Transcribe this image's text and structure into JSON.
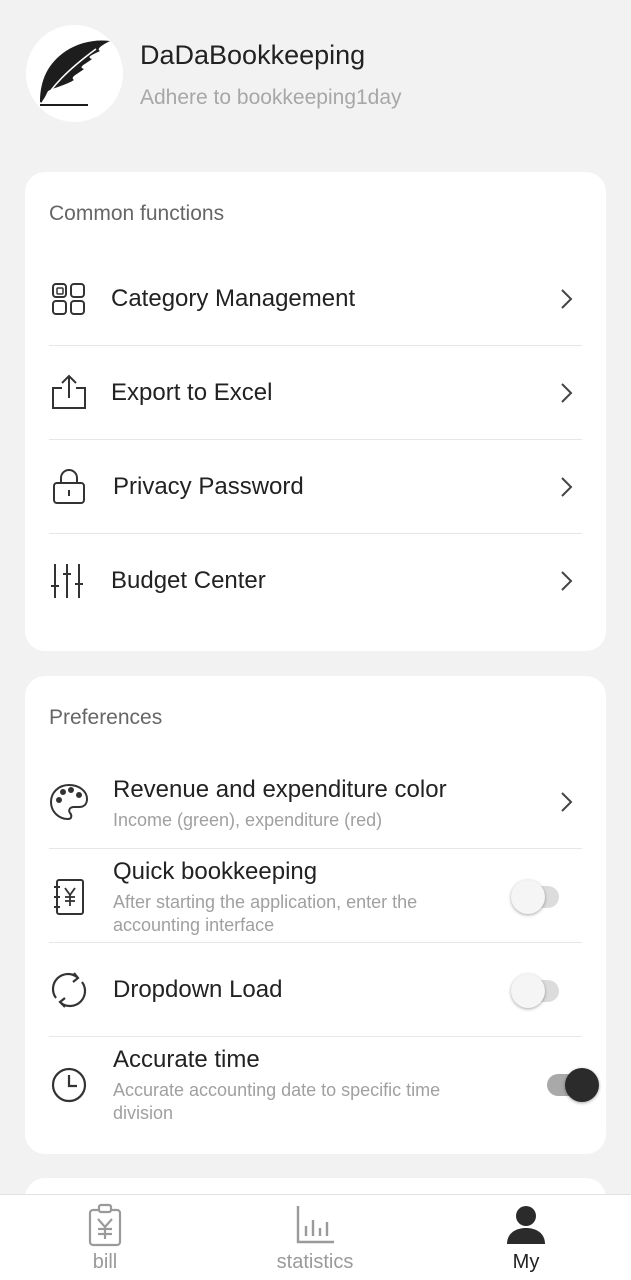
{
  "profile": {
    "app_name": "DaDaBookkeeping",
    "slogan": "Adhere to bookkeeping1day",
    "avatar_icon": "feather-quill-icon"
  },
  "common": {
    "title": "Common functions",
    "items": [
      {
        "label": "Category Management",
        "icon": "grid-icon"
      },
      {
        "label": "Export to Excel",
        "icon": "export-icon"
      },
      {
        "label": "Privacy Password",
        "icon": "lock-icon"
      },
      {
        "label": "Budget Center",
        "icon": "sliders-icon"
      }
    ]
  },
  "preferences": {
    "title": "Preferences",
    "items": [
      {
        "label": "Revenue and expenditure color",
        "sub": "Income (green), expenditure (red)",
        "icon": "palette-icon",
        "control": "chevron"
      },
      {
        "label": "Quick bookkeeping",
        "sub": "After starting the application, enter the accounting interface",
        "icon": "notebook-yen-icon",
        "control": "toggle",
        "enabled": false
      },
      {
        "label": "Dropdown Load",
        "sub": "",
        "icon": "refresh-icon",
        "control": "toggle",
        "enabled": false
      },
      {
        "label": "Accurate time",
        "sub": "Accurate accounting date to specific time division",
        "icon": "clock-icon",
        "control": "toggle",
        "enabled": true
      }
    ]
  },
  "tabs": [
    {
      "label": "bill",
      "icon": "clipboard-yen-icon",
      "active": false
    },
    {
      "label": "statistics",
      "icon": "bar-chart-icon",
      "active": false
    },
    {
      "label": "My",
      "icon": "person-icon",
      "active": true
    }
  ],
  "colors": {
    "background": "#f2f2f2",
    "card": "#ffffff",
    "accent": "#222222",
    "muted_text": "#a0a0a0"
  }
}
